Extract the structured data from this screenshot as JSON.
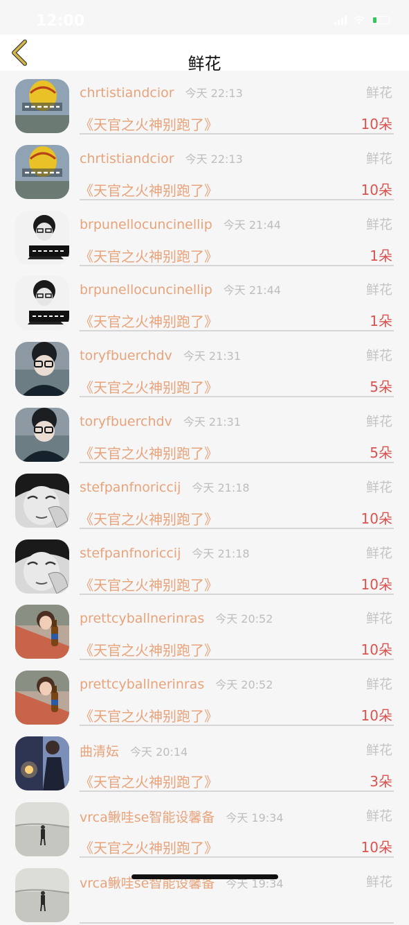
{
  "status_bar": {
    "time": "12:00",
    "colors": {
      "battery": "#34c759"
    }
  },
  "nav": {
    "title": "鲜花",
    "back_icon": "chevron-left-icon",
    "colors": {
      "back_icon": "#d4b84a"
    }
  },
  "colors": {
    "username": "#e8a37b",
    "time": "#bdbdbd",
    "gift_type": "#c4c4c4",
    "work_title": "#e8a37b",
    "count": "#d9534f",
    "divider": "#d6d6d6",
    "background": "#f6f6f6"
  },
  "rows": [
    {
      "user": "chrtistiandcior",
      "time": "今天 22:13",
      "type": "鲜花",
      "work": "《天官之火神别跑了》",
      "count": "10朵",
      "avatar": "balloon"
    },
    {
      "user": "chrtistiandcior",
      "time": "今天 22:13",
      "type": "鲜花",
      "work": "《天官之火神别跑了》",
      "count": "10朵",
      "avatar": "balloon"
    },
    {
      "user": "brpunellocuncinellip",
      "time": "今天 21:44",
      "type": "鲜花",
      "work": "《天官之火神别跑了》",
      "count": "1朵",
      "avatar": "bw-glasses"
    },
    {
      "user": "brpunellocuncinellip",
      "time": "今天 21:44",
      "type": "鲜花",
      "work": "《天官之火神别跑了》",
      "count": "1朵",
      "avatar": "bw-glasses"
    },
    {
      "user": "toryfbuerchdv",
      "time": "今天 21:31",
      "type": "鲜花",
      "work": "《天官之火神别跑了》",
      "count": "5朵",
      "avatar": "glasses-boy"
    },
    {
      "user": "toryfbuerchdv",
      "time": "今天 21:31",
      "type": "鲜花",
      "work": "《天官之火神别跑了》",
      "count": "5朵",
      "avatar": "glasses-boy"
    },
    {
      "user": "stefpanfnoriccij",
      "time": "今天 21:18",
      "type": "鲜花",
      "work": "《天官之火神别跑了》",
      "count": "10朵",
      "avatar": "bw-face"
    },
    {
      "user": "stefpanfnoriccij",
      "time": "今天 21:18",
      "type": "鲜花",
      "work": "《天官之火神别跑了》",
      "count": "10朵",
      "avatar": "bw-face"
    },
    {
      "user": "prettcyballnerinras",
      "time": "今天 20:52",
      "type": "鲜花",
      "work": "《天官之火神别跑了》",
      "count": "10朵",
      "avatar": "girl-bottle"
    },
    {
      "user": "prettcyballnerinras",
      "time": "今天 20:52",
      "type": "鲜花",
      "work": "《天官之火神别跑了》",
      "count": "10朵",
      "avatar": "girl-bottle"
    },
    {
      "user": "曲清妘",
      "time": "今天 20:14",
      "type": "鲜花",
      "work": "《天官之火神别跑了》",
      "count": "3朵",
      "avatar": "night-figure"
    },
    {
      "user": "vrca鳅哇se智能设馨备",
      "time": "今天 19:34",
      "type": "鲜花",
      "work": "《天官之火神别跑了》",
      "count": "10朵",
      "avatar": "field-person"
    },
    {
      "user": "vrca鳅哇se智能设馨备",
      "time": "今天 19:34",
      "type": "鲜花",
      "work": "",
      "count": "",
      "avatar": "field-person"
    }
  ]
}
